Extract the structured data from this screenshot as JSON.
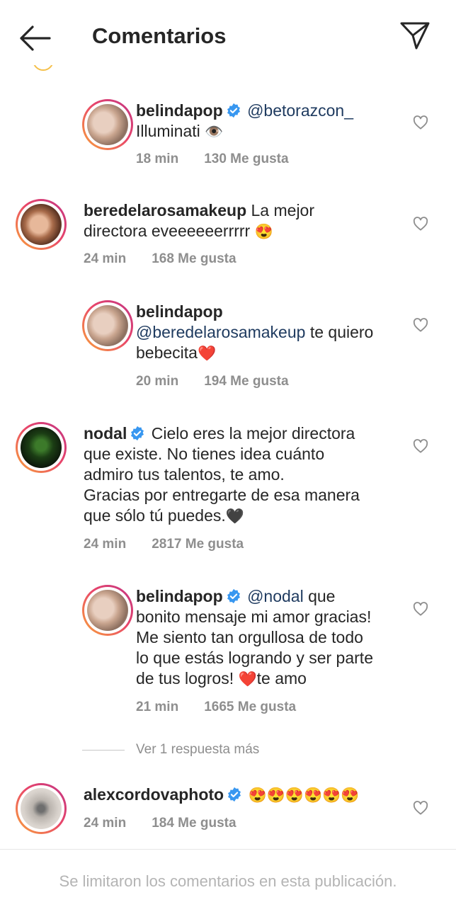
{
  "header": {
    "title": "Comentarios"
  },
  "comments": [
    {
      "username": "belindapop",
      "verified": true,
      "mention": "@betorazcon_",
      "text": "Illuminati",
      "emoji": "👁️",
      "time": "18 min",
      "likes": "130 Me gusta",
      "is_reply": true
    },
    {
      "username": "beredelarosamakeup",
      "verified": false,
      "text_line1": "La mejor",
      "text_line2": "directora eveeeeeerrrrr",
      "emoji": "😍",
      "time": "24 min",
      "likes": "168 Me gusta",
      "is_reply": false
    },
    {
      "username": "belindapop",
      "verified": false,
      "mention": "@beredelarosamakeup",
      "text": "te quiero",
      "text_line3": "bebecita",
      "emoji": "❤️",
      "time": "20 min",
      "likes": "194 Me gusta",
      "is_reply": true
    },
    {
      "username": "nodal",
      "verified": true,
      "text_line1": "Cielo eres la mejor directora",
      "text_line2": "que existe. No tienes idea cuánto",
      "text_line3": "admiro tus talentos, te amo.",
      "text_line4": "Gracias por entregarte de esa manera",
      "text_line5": "que sólo tú puedes.",
      "emoji": "🖤",
      "time": "24 min",
      "likes": "2817 Me gusta",
      "is_reply": false
    },
    {
      "username": "belindapop",
      "verified": true,
      "mention": "@nodal",
      "text_line1": "que",
      "text_line2": "bonito mensaje mi amor gracias!",
      "text_line3": "Me siento tan orgullosa de todo",
      "text_line4": "lo que estás logrando y ser parte",
      "text_line5": "de tus logros!",
      "emoji": "❤️",
      "text_line5b": "te amo",
      "time": "21 min",
      "likes": "1665 Me gusta",
      "is_reply": true
    },
    {
      "username": "alexcordovaphoto",
      "verified": true,
      "emoji": "😍😍😍😍😍😍",
      "time": "24 min",
      "likes": "184 Me gusta",
      "is_reply": false
    }
  ],
  "view_replies": "Ver 1 respuesta más",
  "footer": {
    "notice": "Se limitaron los comentarios en esta publicación."
  },
  "colors": {
    "verified": "#3897f0",
    "meta": "#8e8e8e",
    "mention": "#1e3a5f",
    "ring_start": "#f9a43a",
    "ring_end": "#c13584"
  },
  "icons": {
    "back": "arrow-left-icon",
    "send": "paper-plane-icon",
    "like": "heart-outline-icon",
    "verified": "verified-badge-icon"
  }
}
